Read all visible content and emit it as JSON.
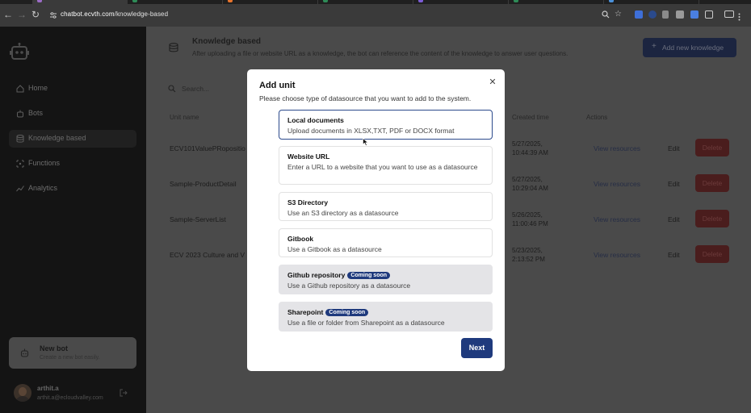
{
  "browser": {
    "url_host": "chatbot.ecvth.com",
    "url_path": "/knowledge-based",
    "tab_favicon_colors": [
      "#9b6cc6",
      "#2e8b57",
      "#e8742c",
      "#2e8b57",
      "#7c5cd6",
      "#2e8b57",
      "#4a90d9"
    ]
  },
  "sidebar": {
    "items": [
      {
        "label": "Home",
        "icon": "home-icon"
      },
      {
        "label": "Bots",
        "icon": "bot-icon"
      },
      {
        "label": "Knowledge based",
        "icon": "database-icon"
      },
      {
        "label": "Functions",
        "icon": "function-icon"
      },
      {
        "label": "Analytics",
        "icon": "analytics-icon"
      }
    ],
    "new_bot": {
      "title": "New bot",
      "subtitle": "Create a new bot easily."
    },
    "user": {
      "name": "arthit.a",
      "email": "arthit.a@ecloudvalley.com"
    }
  },
  "main": {
    "title": "Knowledge based",
    "description": "After uploading a file or website URL as a knowledge, the bot can reference the content of the knowledge to answer user questions.",
    "add_button": "Add new knowledge",
    "search_placeholder": "Search...",
    "columns": {
      "name": "Unit name",
      "created": "Created time",
      "actions": "Actions"
    },
    "rows": [
      {
        "name": "ECV101ValuePRopositio",
        "date": "5/27/2025,",
        "time": "10:44:39 AM"
      },
      {
        "name": "Sample-ProductDetail",
        "date": "5/27/2025,",
        "time": "10:29:04 AM"
      },
      {
        "name": "Sample-ServerList",
        "date": "5/26/2025,",
        "time": "11:00:46 PM"
      },
      {
        "name": "ECV 2023 Culture and V",
        "date": "5/23/2025,",
        "time": "2:13:52 PM"
      }
    ],
    "view_label": "View resources",
    "edit_label": "Edit",
    "delete_label": "Delete"
  },
  "modal": {
    "title": "Add unit",
    "subtitle": "Please choose type of datasource that you want to add to the system.",
    "options": [
      {
        "title": "Local documents",
        "desc": "Upload documents in XLSX,TXT, PDF or DOCX format",
        "state": "selected"
      },
      {
        "title": "Website URL",
        "desc": "Enter a URL to a website that you want to use as a datasource",
        "state": "default"
      },
      {
        "title": "S3 Directory",
        "desc": "Use an S3 directory as a datasource",
        "state": "default"
      },
      {
        "title": "Gitbook",
        "desc": "Use a Gitbook as a datasource",
        "state": "default"
      },
      {
        "title": "Github repository",
        "desc": "Use a Github repository as a datasource",
        "badge": "Coming soon",
        "state": "disabled"
      },
      {
        "title": "Sharepoint",
        "desc": "Use a file or folder from Sharepoint as a datasource",
        "badge": "Coming soon",
        "state": "disabled"
      }
    ],
    "next_label": "Next"
  }
}
